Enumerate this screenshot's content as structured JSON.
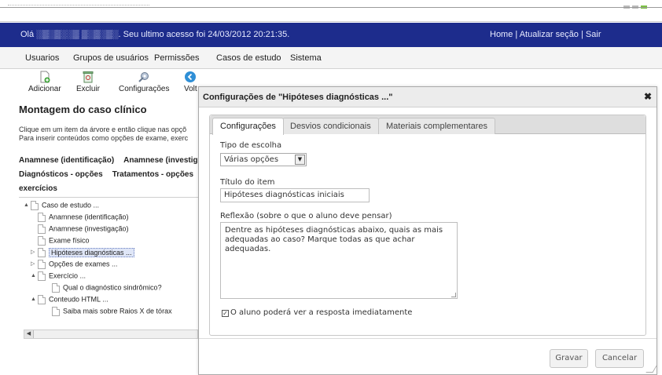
{
  "header": {
    "greeting": "Olá &nbsp;. Seu ultimo acesso foi 24/03/2012 20:21:35.",
    "greeting_text": "Olá ░▒░▒░░▒ ▒░▒░▒░. Seu ultimo acesso foi 24/03/2012 20:21:35.",
    "links": [
      "Home",
      "Atualizar seção",
      "Sair"
    ]
  },
  "menu": [
    "Usuarios",
    "Grupos de usuários",
    "Permissões",
    "Casos de estudo",
    "Sistema"
  ],
  "toolbar": {
    "add": "Adicionar",
    "delete": "Excluir",
    "settings": "Configurações",
    "back": "Volt"
  },
  "left": {
    "title": "Montagem do caso clínico",
    "instr1": "Clique em um item da árvore e então clique nas opçõ",
    "instr2": "Para inserir conteúdos como opções de exame, exerc",
    "cat1": "Anamnese (identificação)",
    "cat2": "Anamnese (investig",
    "cat3": "Diagnósticos - opções",
    "cat4": "Tratamentos - opções",
    "cat5": "exercícios"
  },
  "tree": [
    {
      "label": "Caso de estudo ...",
      "toggle": "▲"
    },
    {
      "label": "Anamnese (identificação)",
      "toggle": ""
    },
    {
      "label": "Anamnese (investigação)",
      "toggle": ""
    },
    {
      "label": "Exame físico",
      "toggle": ""
    },
    {
      "label": "Hipóteses diagnósticas ...",
      "toggle": "▷"
    },
    {
      "label": "Opções de exames ...",
      "toggle": "▷"
    },
    {
      "label": "Exercício ...",
      "toggle": "▲"
    },
    {
      "label": "Qual o diagnóstico sindrômico?",
      "toggle": ""
    },
    {
      "label": "Conteudo HTML ...",
      "toggle": "▲"
    },
    {
      "label": "Saiba mais sobre Raios X de tórax",
      "toggle": ""
    }
  ],
  "dialog": {
    "title": "Configurações de \"Hipóteses diagnósticas ...\"",
    "close": "✖",
    "tabs": [
      "Configurações",
      "Desvios condicionais",
      "Materiais complementares"
    ],
    "choice_label": "Tipo de escolha",
    "choice_value": "Várias opções",
    "item_title_label": "Título do item",
    "item_title_value": "Hipóteses diagnósticas iniciais",
    "reflection_label": "Reflexão (sobre o que o aluno deve pensar)",
    "reflection_value": "Dentre as hipóteses diagnósticas abaixo, quais as mais adequadas ao caso? Marque todas as que achar adequadas.",
    "checkbox_label": "O aluno poderá ver a resposta imediatamente",
    "checkbox_mark": "✓",
    "save": "Gravar",
    "cancel": "Cancelar"
  },
  "colors": {
    "header_bg": "#1d2c8c",
    "selection": "#dfe6f7"
  }
}
